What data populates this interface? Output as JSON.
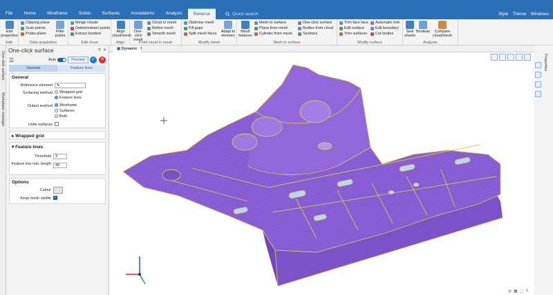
{
  "menu": {
    "tabs": [
      "File",
      "Home",
      "Wireframe",
      "Solids",
      "Surfaces",
      "Annotations",
      "Analysis",
      "Reverse"
    ],
    "active_tab": "Reverse",
    "search_placeholder": "Quick search",
    "right_items": [
      "Style",
      "Theme",
      "Windows"
    ]
  },
  "ribbon": {
    "groups": [
      {
        "label": "Edit",
        "buttons": [
          "Edit properties"
        ]
      },
      {
        "label": "Data acquisition",
        "buttons": [
          "Clipping plane",
          "Scan points",
          "Probe plane",
          "Filter points"
        ]
      },
      {
        "label": "Edit cloud",
        "buttons": [
          "Merge clouds",
          "Delete/extract points",
          "Extract borders"
        ]
      },
      {
        "label": "Align",
        "buttons": [
          "Align cloud/mesh"
        ]
      },
      {
        "label": "Point cloud to mesh",
        "buttons": [
          "One-click mesh",
          "Cloud to mesh",
          "Refine mesh",
          "Smooth mesh"
        ]
      },
      {
        "label": "Modify mesh",
        "buttons": [
          "Optimise mesh",
          "Fill gaps",
          "Split mesh faces",
          "Adapt to element"
        ]
      },
      {
        "label": "Mesh to surface",
        "buttons": [
          "Mesh features",
          "Mesh to surface",
          "Plane from mesh",
          "Cylinder from mesh",
          "One-click surface",
          "Bodies from cloud",
          "Sections"
        ]
      },
      {
        "label": "Modify surface",
        "buttons": [
          "Trim face-face",
          "Edit surface",
          "Trim surfaces",
          "Automatic trim",
          "Edit boundary",
          "Cut bodies"
        ]
      },
      {
        "label": "Analysis",
        "buttons": [
          "Sew sheets",
          "Boolean",
          "Compare cloud/mesh"
        ]
      }
    ]
  },
  "left_strip": {
    "items": [
      "One-click surface",
      "Workplane manager"
    ]
  },
  "panel": {
    "title": "One-click surface",
    "auto_label": "Auto",
    "preview_label": "Preview",
    "tabs": [
      "General",
      "Feature lines"
    ],
    "active_tab": "General",
    "general": {
      "header": "General",
      "reference_element_label": "Reference element",
      "surfacing_method_label": "Surfacing method",
      "surfacing_options": [
        "Wrapped grid",
        "Feature lines"
      ],
      "surfacing_selected": "Feature lines",
      "output_method_label": "Output method",
      "output_options": [
        "Wireframe",
        "Surfaces",
        "Both"
      ],
      "output_selected": "Wireframe",
      "unite_surfaces_label": "Unite surfaces",
      "unite_surfaces": false
    },
    "wrapped_grid": {
      "header": "Wrapped grid"
    },
    "feature_lines": {
      "header": "Feature lines",
      "threshold_label": "Threshold",
      "threshold_value": "3",
      "min_length_label": "Feature line min. length",
      "min_length_value": "40"
    },
    "options": {
      "header": "Options",
      "colour_label": "Colour",
      "keep_mesh_label": "Keep mesh visible",
      "keep_mesh": true
    }
  },
  "viewport": {
    "tab_label": "Dynamic",
    "model_color": "#8a5fd6",
    "edge_color": "#e2c04a"
  },
  "colors": {
    "accent": "#2a6fb8",
    "ok": "#1e78d4",
    "cancel": "#d62c2c"
  }
}
